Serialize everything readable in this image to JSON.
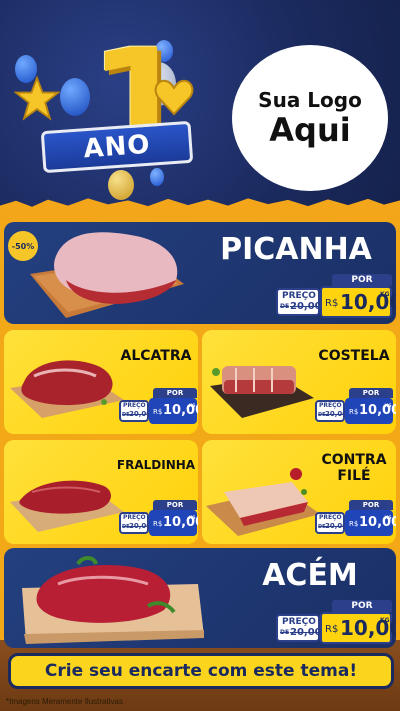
{
  "header": {
    "anniversary_number": "1",
    "ribbon_text": "ANO",
    "logo_line1": "Sua Logo",
    "logo_line2": "Aqui"
  },
  "discount_badge": "-50%",
  "products": [
    {
      "name": "PICANHA",
      "por": "POR",
      "preco_label": "PREÇO",
      "old_prefix": "DE",
      "old_price": "20,00",
      "currency": "R$",
      "price": "10,00",
      "unit": "KG"
    },
    {
      "name": "ALCATRA",
      "por": "POR",
      "preco_label": "PREÇO",
      "old_prefix": "DE",
      "old_price": "20,00",
      "currency": "R$",
      "price": "10,00",
      "unit": "KG"
    },
    {
      "name": "COSTELA",
      "por": "POR",
      "preco_label": "PREÇO",
      "old_prefix": "DE",
      "old_price": "20,00",
      "currency": "R$",
      "price": "10,00",
      "unit": "KG"
    },
    {
      "name": "FRALDINHA",
      "por": "POR",
      "preco_label": "PREÇO",
      "old_prefix": "DE",
      "old_price": "20,00",
      "currency": "R$",
      "price": "10,00",
      "unit": "KG"
    },
    {
      "name_line1": "CONTRA",
      "name_line2": "FILÉ",
      "por": "POR",
      "preco_label": "PREÇO",
      "old_prefix": "DE",
      "old_price": "20,00",
      "currency": "R$",
      "price": "10,00",
      "unit": "KG"
    },
    {
      "name": "ACÉM",
      "por": "POR",
      "preco_label": "PREÇO",
      "old_prefix": "DE",
      "old_price": "20,00",
      "currency": "R$",
      "price": "10,00",
      "unit": "KG"
    }
  ],
  "footer": {
    "cta": "Crie seu encarte com este tema!",
    "disclaimer": "*Imagens Meramente Ilustrativas"
  },
  "colors": {
    "navy": "#1b2a5e",
    "yellow": "#ffd10a",
    "orange": "#f2a817",
    "price_blue": "#1f45b8"
  }
}
